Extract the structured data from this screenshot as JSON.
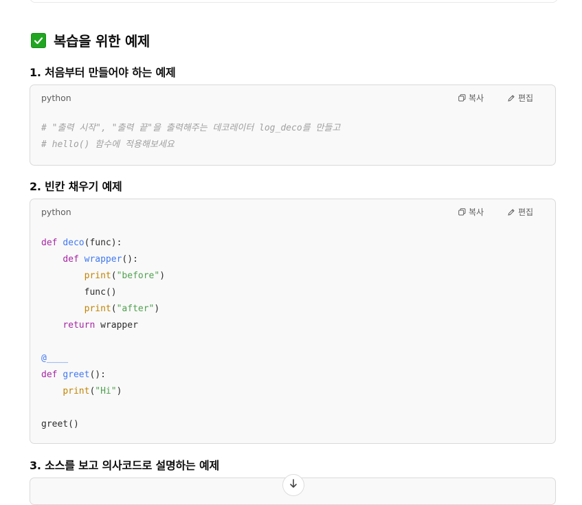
{
  "heading": {
    "emoji": "✅",
    "title": "복습을 위한 예제"
  },
  "sections": [
    {
      "title": "1. 처음부터 만들어야 하는 예제",
      "lang": "python",
      "copy_label": "복사",
      "edit_label": "편집",
      "code_lines": [
        "# \"출력 시작\", \"출력 끝\"을 출력해주는 데코레이터 log_deco를 만들고",
        "# hello() 함수에 적용해보세요"
      ]
    },
    {
      "title": "2. 빈칸 채우기 예제",
      "lang": "python",
      "copy_label": "복사",
      "edit_label": "편집",
      "code_lines": [
        "def deco(func):",
        "    def wrapper():",
        "        print(\"before\")",
        "        func()",
        "        print(\"after\")",
        "    return wrapper",
        "",
        "@____",
        "def greet():",
        "    print(\"Hi\")",
        "",
        "greet()"
      ]
    },
    {
      "title": "3. 소스를 보고 의사코드로 설명하는 예제"
    }
  ],
  "icons": {
    "heading_checkbox": "check-mark-button-icon",
    "copy": "copy-icon",
    "edit": "pencil-icon",
    "scroll_down": "arrow-down-icon"
  },
  "colors": {
    "keyword": "#a626a4",
    "function": "#4078f2",
    "builtin": "#c18401",
    "string": "#50a14f",
    "comment": "#a0a0a0",
    "check_green": "#21a621"
  }
}
